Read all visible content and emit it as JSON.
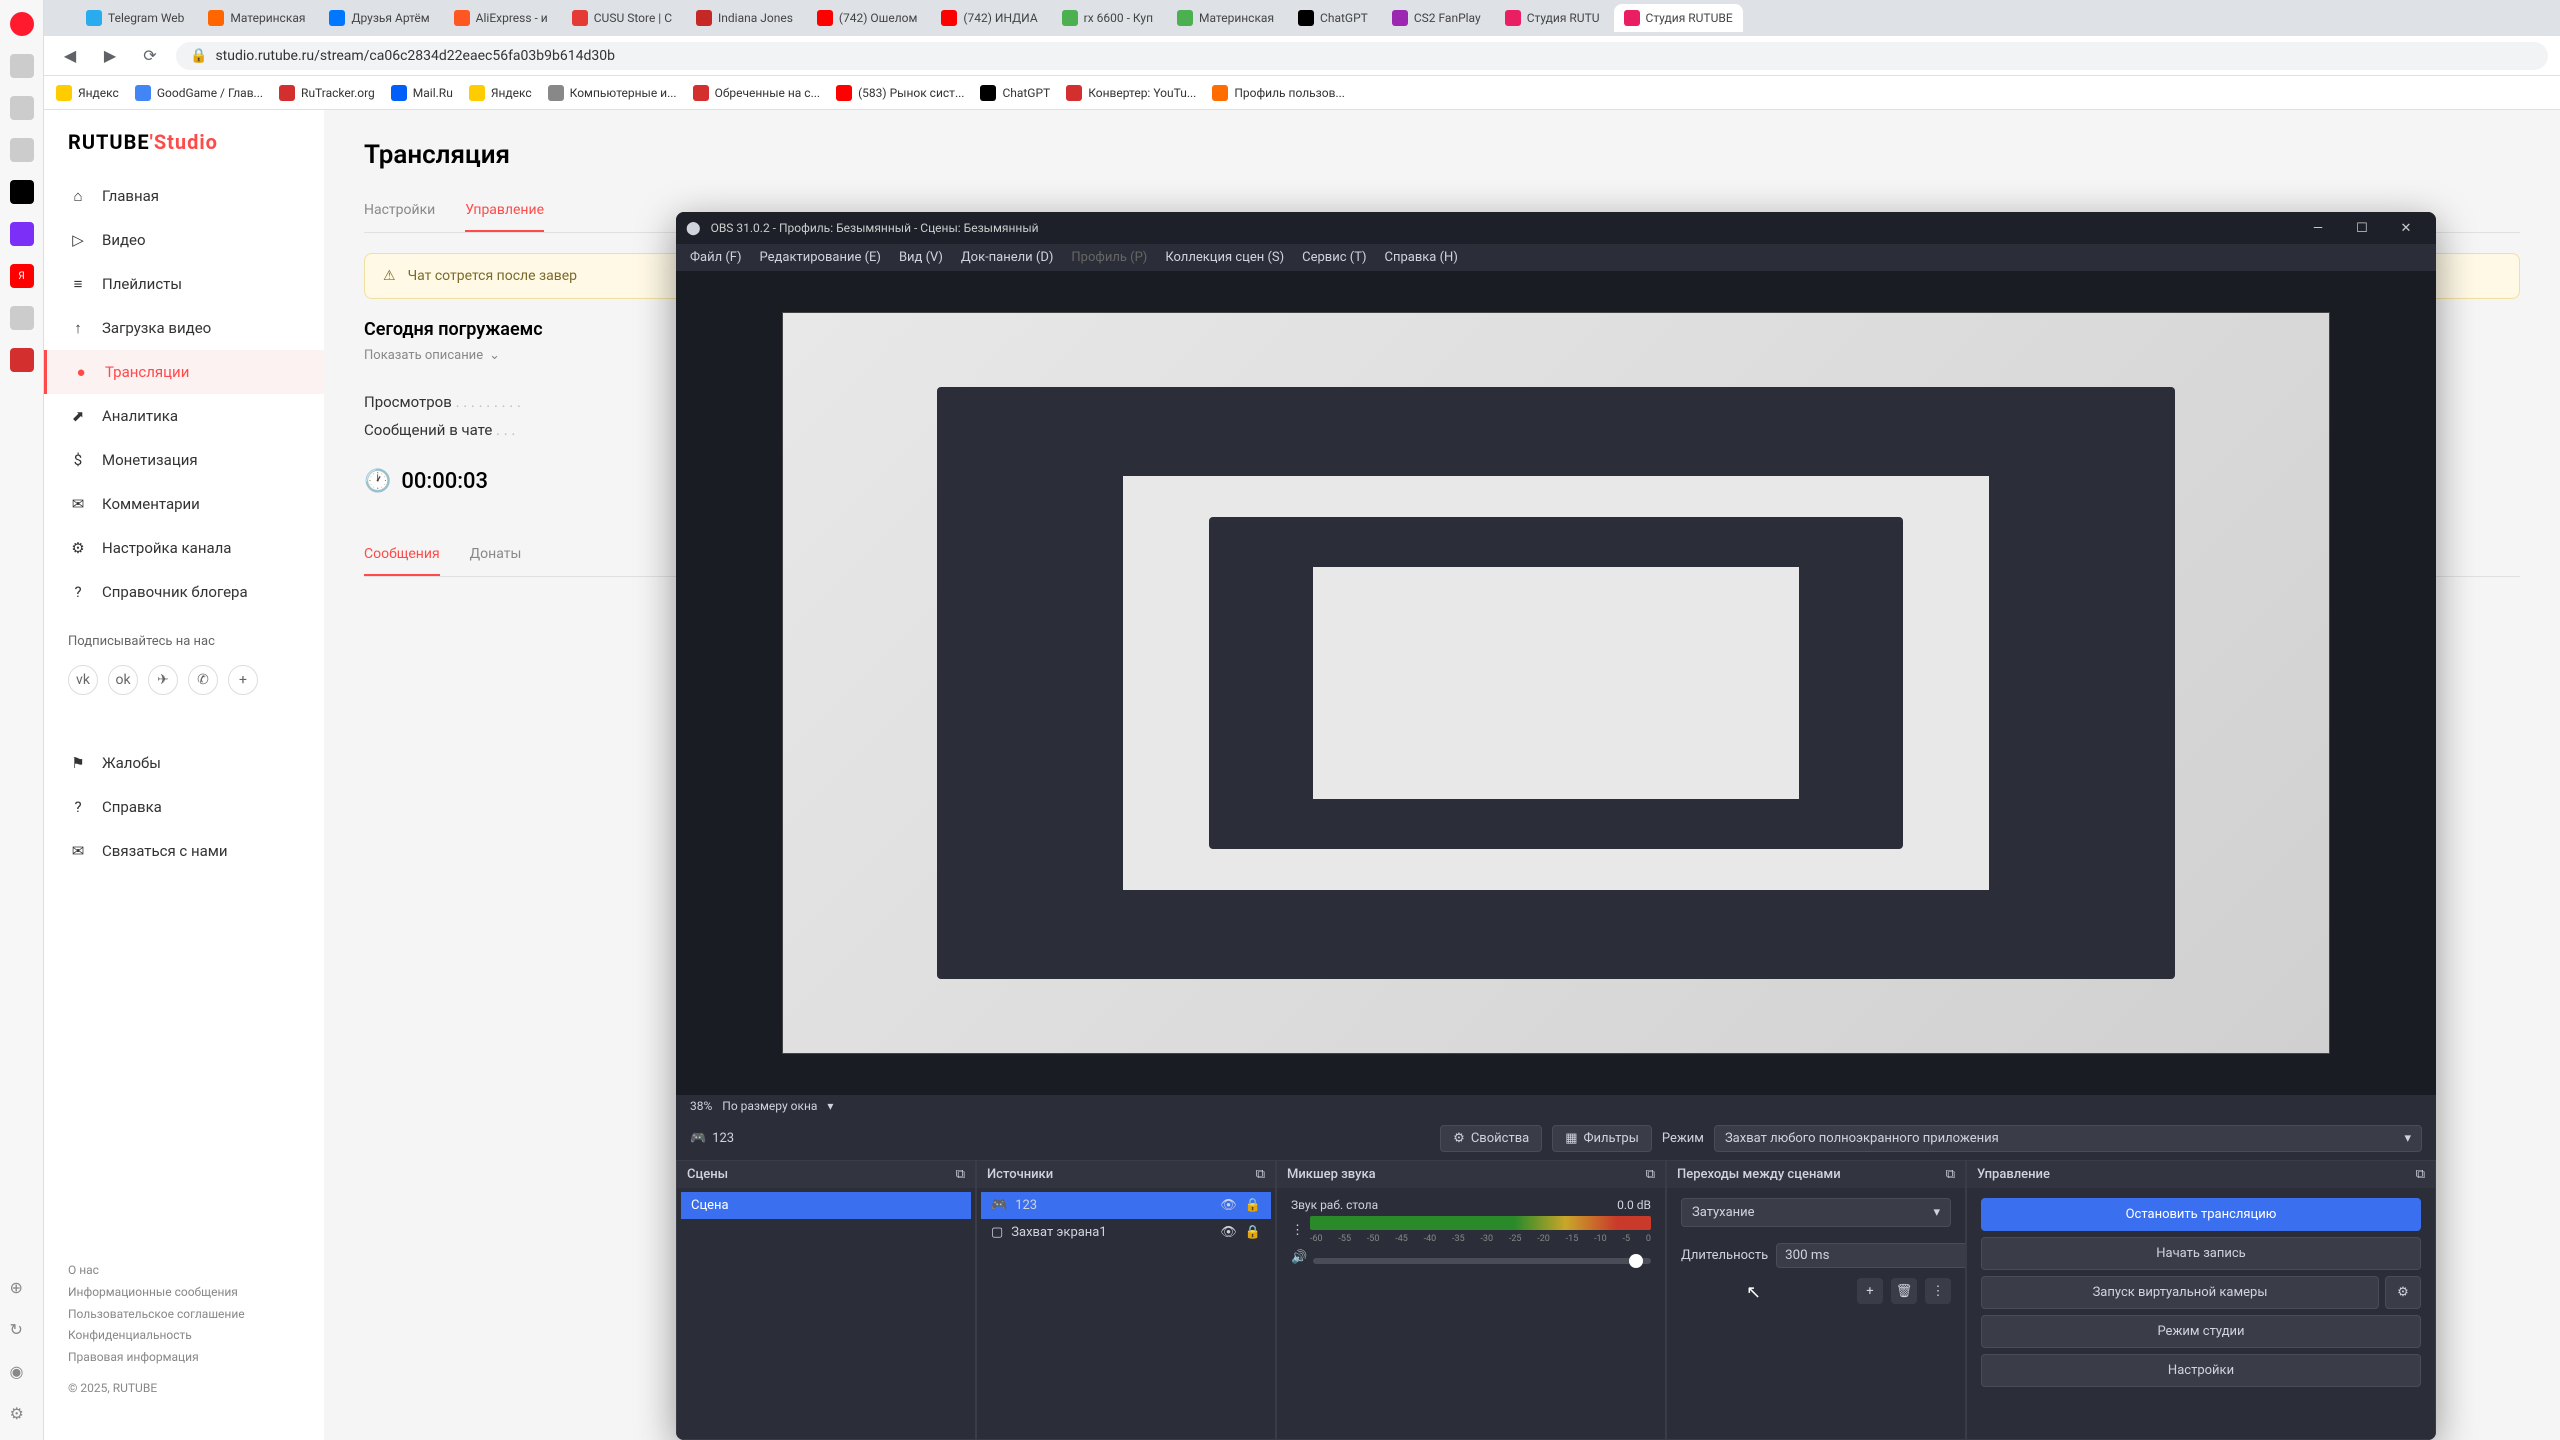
{
  "browser": {
    "tabs": [
      {
        "label": "Telegram Web",
        "color": "#2aabee"
      },
      {
        "label": "Материнская",
        "color": "#ff6600"
      },
      {
        "label": "Друзья Артём",
        "color": "#0077ff"
      },
      {
        "label": "AliExpress - и",
        "color": "#ff5722"
      },
      {
        "label": "CUSU Store | C",
        "color": "#e53935"
      },
      {
        "label": "Indiana Jones",
        "color": "#c62828"
      },
      {
        "label": "(742) Ошелом",
        "color": "#ff0000"
      },
      {
        "label": "(742) ИНДИА",
        "color": "#ff0000"
      },
      {
        "label": "rx 6600 - Куп",
        "color": "#4caf50"
      },
      {
        "label": "Материнская",
        "color": "#4caf50"
      },
      {
        "label": "ChatGPT",
        "color": "#000000"
      },
      {
        "label": "CS2 FanPlay",
        "color": "#9c27b0"
      },
      {
        "label": "Студия RUTU",
        "color": "#e91e63"
      },
      {
        "label": "Студия RUTUBE",
        "color": "#e91e63",
        "active": true
      }
    ],
    "url": "studio.rutube.ru/stream/ca06c2834d22eaec56fa03b9b614d30b",
    "bookmarks": [
      {
        "label": "Яндекс",
        "color": "#ffcc00"
      },
      {
        "label": "GoodGame / Глав...",
        "color": "#4285f4"
      },
      {
        "label": "RuTracker.org",
        "color": "#d32f2f"
      },
      {
        "label": "Mail.Ru",
        "color": "#005ff9"
      },
      {
        "label": "Яндекс",
        "color": "#ffcc00"
      },
      {
        "label": "Компьютерные и...",
        "color": "#888"
      },
      {
        "label": "Обреченные на с...",
        "color": "#d32f2f"
      },
      {
        "label": "(583) Рынок сист...",
        "color": "#ff0000"
      },
      {
        "label": "ChatGPT",
        "color": "#000"
      },
      {
        "label": "Конвертер: YouTu...",
        "color": "#d32f2f"
      },
      {
        "label": "Профиль пользов...",
        "color": "#ff6d00"
      }
    ]
  },
  "rutube": {
    "logo_main": "RUTUBE",
    "logo_suffix": "Studio",
    "nav": [
      {
        "label": "Главная",
        "icon": "⌂"
      },
      {
        "label": "Видео",
        "icon": "▷"
      },
      {
        "label": "Плейлисты",
        "icon": "≡"
      },
      {
        "label": "Загрузка видео",
        "icon": "↑"
      },
      {
        "label": "Трансляции",
        "icon": "●",
        "active": true
      },
      {
        "label": "Аналитика",
        "icon": "⬈"
      },
      {
        "label": "Монетизация",
        "icon": "$"
      },
      {
        "label": "Комментарии",
        "icon": "✉"
      },
      {
        "label": "Настройка канала",
        "icon": "⚙"
      },
      {
        "label": "Справочник блогера",
        "icon": "?"
      }
    ],
    "subscribe_label": "Подписывайтесь на нас",
    "bottom_nav": [
      {
        "label": "Жалобы",
        "icon": "⚑"
      },
      {
        "label": "Справка",
        "icon": "?"
      },
      {
        "label": "Связаться с нами",
        "icon": "✉"
      }
    ],
    "footer": {
      "about": "О нас",
      "info": "Информационные сообщения",
      "agreement": "Пользовательское соглашение",
      "privacy": "Конфиденциальность",
      "legal": "Правовая информация",
      "copyright": "© 2025, RUTUBE"
    },
    "main": {
      "title": "Трансляция",
      "tabs": [
        "Настройки",
        "Управление"
      ],
      "active_tab": 1,
      "warning": "Чат сотрется после завер",
      "section_title": "Сегодня погружаемс",
      "show_desc": "Показать описание",
      "views_label": "Просмотров",
      "views_dots": ". . . . . . . . .",
      "chat_label": "Сообщений в чате",
      "chat_dots": ". . .",
      "duration": "00:00:03",
      "bottom_tabs": [
        "Сообщения",
        "Донаты"
      ],
      "bottom_active": 0
    }
  },
  "obs": {
    "title": "OBS 31.0.2 - Профиль: Безымянный - Сцены: Безымянный",
    "menu": [
      {
        "label": "Файл (F)"
      },
      {
        "label": "Редактирование (E)"
      },
      {
        "label": "Вид (V)"
      },
      {
        "label": "Док-панели (D)"
      },
      {
        "label": "Профиль (P)",
        "disabled": true
      },
      {
        "label": "Коллекция сцен (S)"
      },
      {
        "label": "Сервис (T)"
      },
      {
        "label": "Справка (H)"
      }
    ],
    "zoom_pct": "38%",
    "zoom_mode": "По размеру окна",
    "toolbar": {
      "source_name": "123",
      "properties": "Свойства",
      "filters": "Фильтры",
      "mode_label": "Режим",
      "mode_value": "Захват любого полноэкранного приложения"
    },
    "panels": {
      "scenes": {
        "title": "Сцены",
        "items": [
          "Сцена"
        ]
      },
      "sources": {
        "title": "Источники",
        "items": [
          {
            "label": "123",
            "icon": "🎮",
            "selected": true
          },
          {
            "label": "Захват экрана1",
            "icon": "▢"
          }
        ]
      },
      "mixer": {
        "title": "Микшер звука",
        "track_name": "Звук раб. стола",
        "track_db": "0.0 dB",
        "scale": [
          "-60",
          "-55",
          "-50",
          "-45",
          "-40",
          "-35",
          "-30",
          "-25",
          "-20",
          "-15",
          "-10",
          "-5",
          "0"
        ]
      },
      "transitions": {
        "title": "Переходы между сценами",
        "type": "Затухание",
        "duration_label": "Длительность",
        "duration_value": "300 ms"
      },
      "controls": {
        "title": "Управление",
        "stop_stream": "Остановить трансляцию",
        "start_record": "Начать запись",
        "virtual_cam": "Запуск виртуальной камеры",
        "studio_mode": "Режим студии",
        "settings": "Настройки"
      }
    }
  }
}
